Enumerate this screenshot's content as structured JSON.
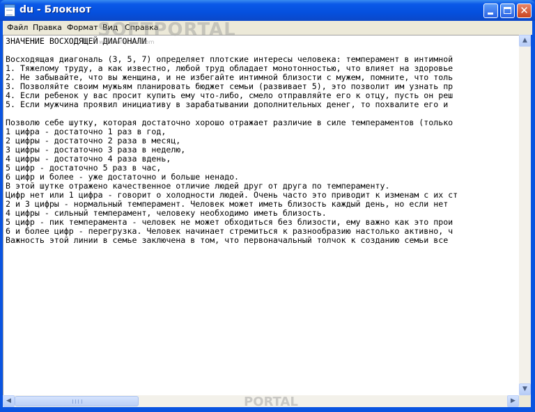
{
  "window": {
    "title": "du - Блокнот"
  },
  "menu": {
    "file": "Файл",
    "edit": "Правка",
    "format": "Формат",
    "view": "Вид",
    "help": "Справка"
  },
  "watermark": {
    "main": "SOFTPORTAL",
    "sub": "www.softportal.com",
    "bottom": "PORTAL"
  },
  "editor": {
    "lines": [
      "ЗНАЧЕНИЕ ВОСХОДЯЩЕЙ ДИАГОНАЛИ",
      "",
      "Восходящая диагональ (3, 5, 7) определяет плотские интересы человека: темперамент в интимной",
      "1. Тяжелому труду, а как известно, любой труд обладает монотонностью, что влияет на здоровье",
      "2. Не забывайте, что вы женщина, и не избегайте интимной близости с мужем, помните, что толь",
      "3. Позволяйте своим мужьям планировать бюджет семьи (развивает 5), это позволит им узнать пр",
      "4. Если ребенок у вас просит купить ему что-либо, смело отправляйте его к отцу, пусть он реш",
      "5. Если мужчина проявил инициативу в зарабатывании дополнительных денег, то похвалите его и ",
      "",
      "Позволю себе шутку, которая достаточно хорошо отражает различие в силе темпераментов (только",
      "1 цифра - достаточно 1 раз в год,",
      "2 цифры - достаточно 2 раза в месяц,",
      "3 цифры - достаточно 3 раза в неделю,",
      "4 цифры - достаточно 4 раза вдень,",
      "5 цифр - достаточно 5 раз в час,",
      "6 цифр и более - уже достаточно и больше ненадо.",
      "В этой шутке отражено качественное отличие людей друг от друга по темпераменту.",
      "Цифр нет или 1 цифра - говорит о холодности людей. Очень часто это приводит к изменам с их ст",
      "2 и 3 цифры - нормальный темперамент. Человек может иметь близость каждый день, но если нет ",
      "4 цифры - сильный темперамент, человеку необходимо иметь близость.",
      "5 цифр - пик темперамента - человек не может обходиться без близости, ему важно как это прои",
      "6 и более цифр - перегрузка. Человек начинает стремиться к разнообразию настолько активно, ч",
      "Важность этой линии в семье заключена в том, что первоначальный толчок к созданию семьи все "
    ]
  },
  "icons": {
    "app": "notepad-icon",
    "minimize": "minimize-icon",
    "maximize": "maximize-icon",
    "close": "close-icon",
    "scroll_up": "arrow-up-icon",
    "scroll_down": "arrow-down-icon",
    "scroll_left": "arrow-left-icon",
    "scroll_right": "arrow-right-icon"
  },
  "glyphs": {
    "close": "✕",
    "up": "▲",
    "down": "▼",
    "left": "◀",
    "right": "▶"
  },
  "colors": {
    "titlebar": "#0550de",
    "close_button": "#c9431e",
    "menubar": "#ece9d8"
  }
}
